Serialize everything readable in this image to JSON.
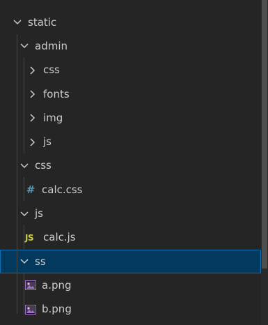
{
  "explorer": {
    "items": [
      {
        "label": "static",
        "expanded": true,
        "depth": 0
      },
      {
        "label": "admin",
        "expanded": true,
        "depth": 1
      },
      {
        "label": "css",
        "expanded": false,
        "depth": 2
      },
      {
        "label": "fonts",
        "expanded": false,
        "depth": 2
      },
      {
        "label": "img",
        "expanded": false,
        "depth": 2
      },
      {
        "label": "js",
        "expanded": false,
        "depth": 2
      },
      {
        "label": "css",
        "expanded": true,
        "depth": 1
      },
      {
        "label": "calc.css",
        "icon": "css-file-icon",
        "icon_glyph": "#",
        "depth": 2
      },
      {
        "label": "js",
        "expanded": true,
        "depth": 1
      },
      {
        "label": "calc.js",
        "icon": "js-file-icon",
        "icon_glyph": "JS",
        "depth": 2
      },
      {
        "label": "ss",
        "expanded": true,
        "depth": 1,
        "selected": true
      },
      {
        "label": "a.png",
        "icon": "image-file-icon",
        "depth": 2
      },
      {
        "label": "b.png",
        "icon": "image-file-icon",
        "depth": 2
      }
    ]
  },
  "colors": {
    "background": "#252526",
    "text": "#cccccc",
    "selected_background": "#04395e",
    "selected_border": "#0a6fb4",
    "css_icon": "#519aba",
    "js_icon": "#cbcb41",
    "image_icon": "#a074c4"
  }
}
